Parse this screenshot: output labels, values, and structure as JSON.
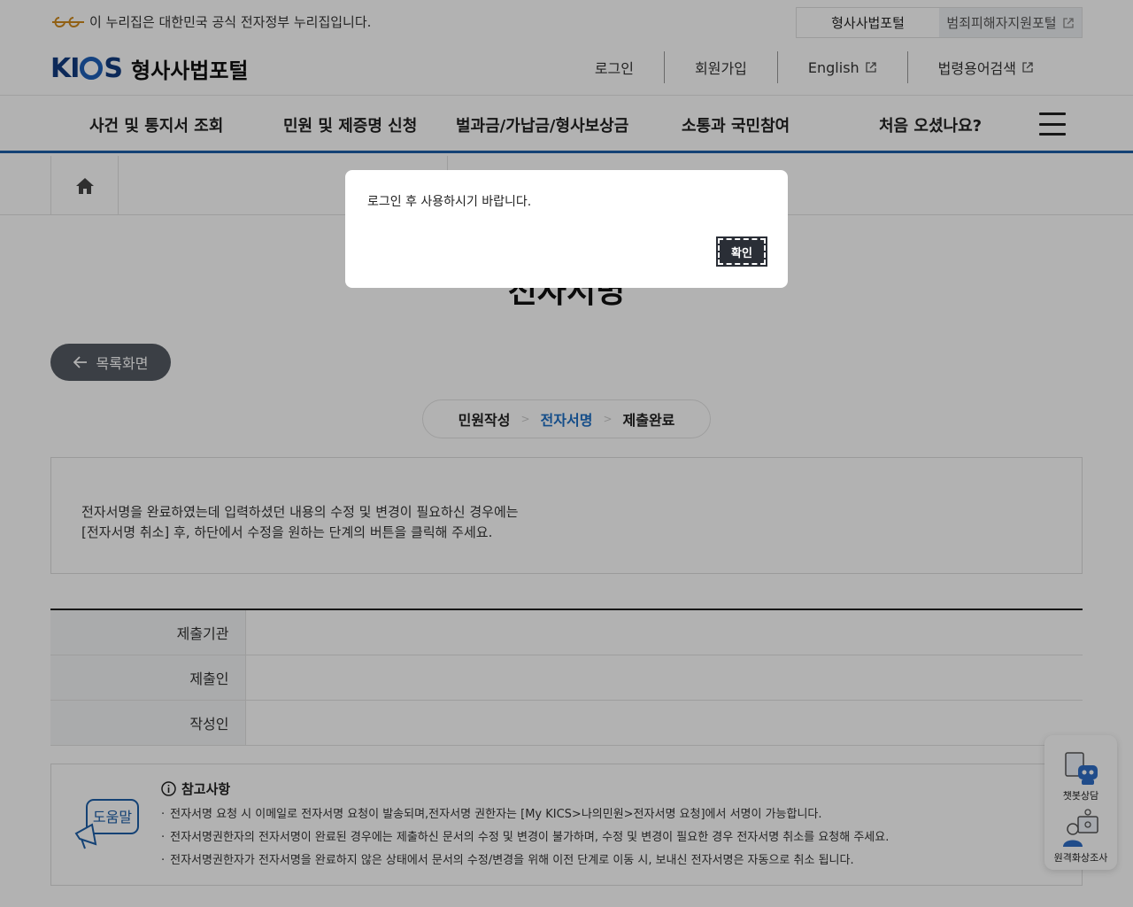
{
  "gov_banner": {
    "text": "이 누리집은 대한민국 공식 전자정부 누리집입니다.",
    "tabs": [
      {
        "label": "형사사법포털"
      },
      {
        "label": "범죄피해자지원포털"
      }
    ]
  },
  "header": {
    "logo_mark": "KICS",
    "logo_text": "형사사법포털",
    "util_nav": [
      {
        "label": "로그인"
      },
      {
        "label": "회원가입"
      },
      {
        "label": "English"
      },
      {
        "label": "법령용어검색"
      }
    ]
  },
  "gnb": {
    "items": [
      {
        "label": "사건 및 통지서 조회"
      },
      {
        "label": "민원 및 제증명 신청"
      },
      {
        "label": "벌과금/가납금/형사보상금"
      },
      {
        "label": "소통과 국민참여"
      },
      {
        "label": "처음 오셨나요?"
      }
    ]
  },
  "page": {
    "title": "전자서명",
    "back_label": "목록화면",
    "steps": [
      {
        "label": "민원작성",
        "active": false
      },
      {
        "label": "전자서명",
        "active": true
      },
      {
        "label": "제출완료",
        "active": false
      }
    ],
    "notice_line1": "전자서명을 완료하였는데 입력하셨던 내용의 수정 및 변경이 필요하신 경우에는",
    "notice_line2": "[전자서명 취소] 후, 하단에서 수정을 원하는 단계의 버튼을 클릭해 주세요.",
    "table_rows": [
      {
        "label": "제출기관",
        "value": ""
      },
      {
        "label": "제출인",
        "value": ""
      },
      {
        "label": "작성인",
        "value": ""
      }
    ]
  },
  "help": {
    "icon_label": "도움말",
    "title": "참고사항",
    "items": [
      "전자서명 요청 시 이메일로 전자서명 요청이 발송되며,전자서명 권한자는 [My KICS>나의민원>전자서명 요청]에서 서명이 가능합니다.",
      "전자서명권한자의 전자서명이 완료된 경우에는 제출하신 문서의 수정 및 변경이 불가하며, 수정 및 변경이 필요한 경우 전자서명 취소를 요청해 주세요.",
      "전자서명권한자가 전자서명을 완료하지 않은 상태에서 문서의 수정/변경을 위해 이전 단계로 이동 시, 보내신 전자서명은 자동으로 취소 됩니다."
    ]
  },
  "floating": {
    "chatbot_label": "챗봇상담",
    "video_label": "원격화상조사"
  },
  "dialog": {
    "message": "로그인 후 사용하시기 바랍니다.",
    "confirm_label": "확인"
  },
  "colors": {
    "accent": "#1e5fa8",
    "active_step": "#1e6fc4",
    "button_dark": "#2a2e36"
  }
}
